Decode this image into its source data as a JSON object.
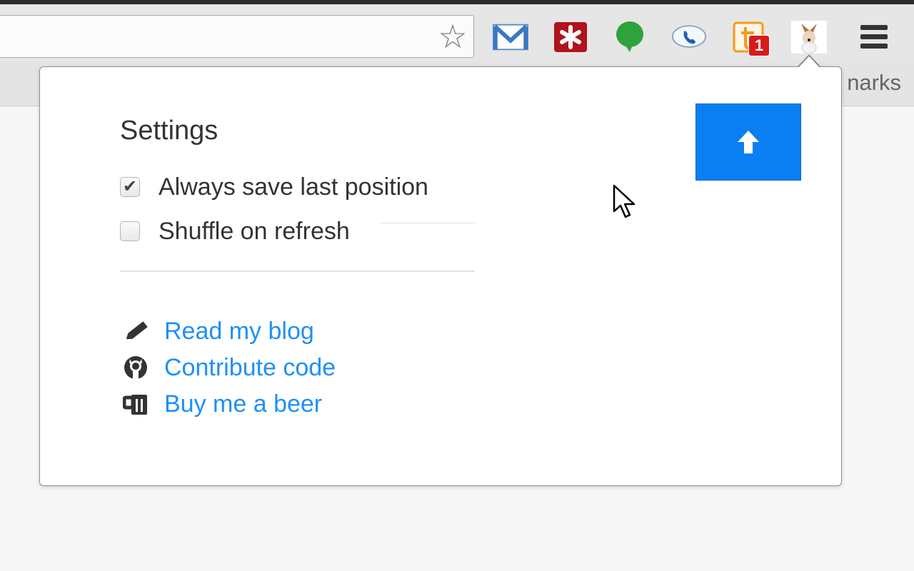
{
  "browser": {
    "bookmarks_label": "narks",
    "star_icon": "star-icon",
    "extensions": [
      {
        "name": "gmail-icon"
      },
      {
        "name": "lastpass-icon"
      },
      {
        "name": "chat-bubble-icon"
      },
      {
        "name": "phone-bubble-icon"
      },
      {
        "name": "tumblr-icon",
        "badge": "1"
      },
      {
        "name": "dog-extension-icon"
      }
    ],
    "menu_icon": "hamburger-menu-icon"
  },
  "popup": {
    "title": "Settings",
    "options": [
      {
        "label": "Always save last position",
        "checked": true
      },
      {
        "label": "Shuffle on refresh",
        "checked": false
      }
    ],
    "links": [
      {
        "label": "Read my blog",
        "icon": "pencil-icon"
      },
      {
        "label": "Contribute code",
        "icon": "github-icon"
      },
      {
        "label": "Buy me a beer",
        "icon": "beer-mug-icon"
      }
    ],
    "scroll_up_button": {
      "icon": "arrow-up-icon",
      "color": "#0a7ff2"
    },
    "link_color": "#1e90f5"
  }
}
